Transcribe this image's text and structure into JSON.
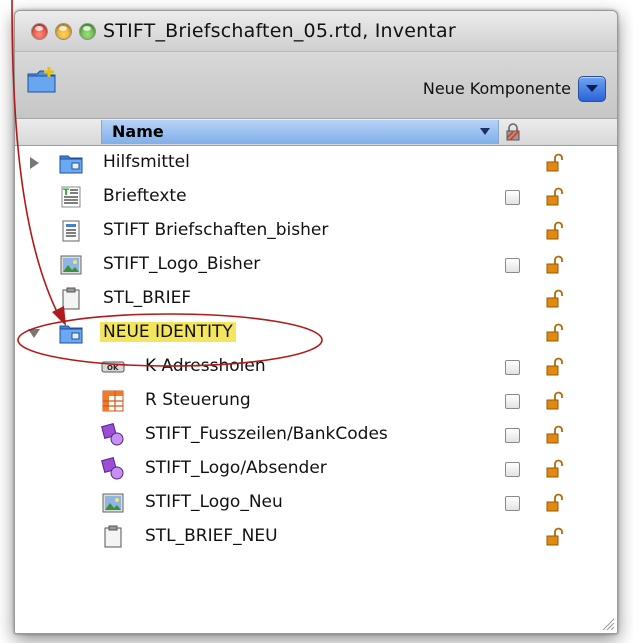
{
  "window": {
    "title": "STIFT_Briefschaften_05.rtd, Inventar"
  },
  "toolbar": {
    "new_component_label": "Neue Komponente",
    "add_folder_icon": "folder-add-icon",
    "dropdown_icon": "dropdown-arrow-icon"
  },
  "columns": {
    "name": "Name",
    "lock_header_icon": "lock-column-icon"
  },
  "rows": [
    {
      "label": "Hilfsmittel",
      "icon": "folder-icon",
      "indent": 0,
      "disclosure": "collapsed",
      "checkbox": false
    },
    {
      "label": "Brieftexte",
      "icon": "text-document-icon",
      "indent": 0,
      "disclosure": "none",
      "checkbox": true
    },
    {
      "label": "STIFT Briefschaften_bisher",
      "icon": "form-document-icon",
      "indent": 0,
      "disclosure": "none",
      "checkbox": false
    },
    {
      "label": "STIFT_Logo_Bisher",
      "icon": "image-icon",
      "indent": 0,
      "disclosure": "none",
      "checkbox": true
    },
    {
      "label": "STL_BRIEF",
      "icon": "clipboard-icon",
      "indent": 0,
      "disclosure": "none",
      "checkbox": false
    },
    {
      "label": "NEUE IDENTITY",
      "icon": "folder-icon",
      "indent": 0,
      "disclosure": "expanded",
      "checkbox": false,
      "highlighted": true
    },
    {
      "label": "K Adressholen",
      "icon": "ok-button-icon",
      "indent": 1,
      "disclosure": "none",
      "checkbox": true
    },
    {
      "label": "R Steuerung",
      "icon": "table-icon",
      "indent": 1,
      "disclosure": "none",
      "checkbox": true
    },
    {
      "label": "STIFT_Fusszeilen/BankCodes",
      "icon": "shapes-icon",
      "indent": 1,
      "disclosure": "none",
      "checkbox": true
    },
    {
      "label": "STIFT_Logo/Absender",
      "icon": "shapes-icon",
      "indent": 1,
      "disclosure": "none",
      "checkbox": true
    },
    {
      "label": "STIFT_Logo_Neu",
      "icon": "image-icon",
      "indent": 1,
      "disclosure": "none",
      "checkbox": true
    },
    {
      "label": "STL_BRIEF_NEU",
      "icon": "clipboard-icon",
      "indent": 1,
      "disclosure": "none",
      "checkbox": false
    }
  ],
  "colors": {
    "highlight": "#f4e55e",
    "annotation": "#b01a1a",
    "selection_header": "#7fb0ea",
    "lock": "#e08a10"
  }
}
